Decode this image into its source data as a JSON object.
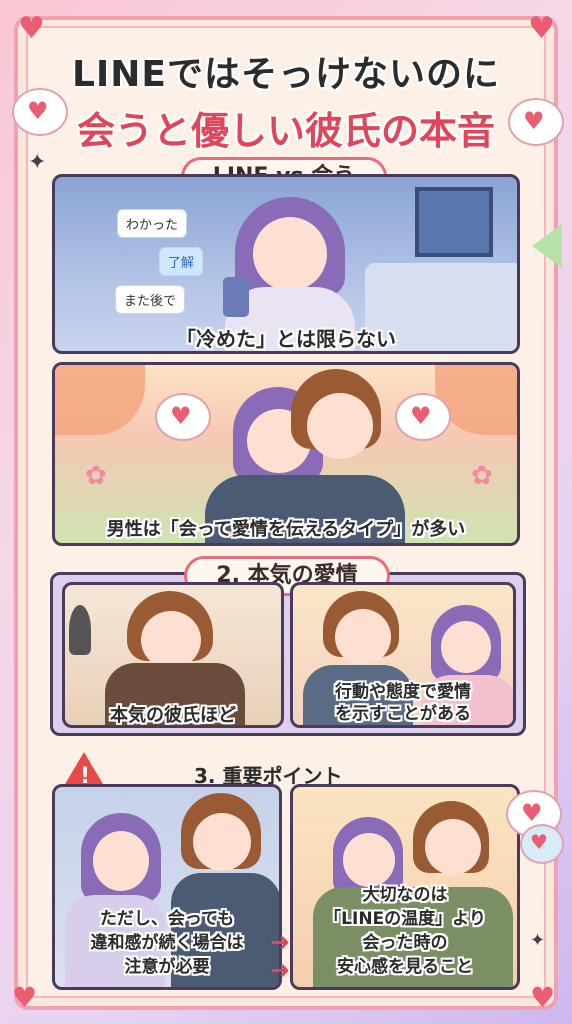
{
  "title": {
    "line1": "LINEではそっけないのに",
    "line2": "会うと優しい彼氏の本音"
  },
  "sections": {
    "s1_label": "LINE vs 会う",
    "s2_label": "2. 本気の愛情",
    "s3_label": "3. 重要ポイント"
  },
  "chat": {
    "msg1": "わかった",
    "msg2": "了解",
    "msg3": "また後で"
  },
  "captions": {
    "c1": "「冷めた」とは限らない",
    "c2": "男性は「会って愛情を伝えるタイプ」が多い",
    "c3": "本気の彼氏ほど",
    "c4_line1": "行動や態度で愛情",
    "c4_line2": "を示すことがある",
    "c5_line1": "ただし、会っても",
    "c5_line2": "違和感が続く場合は",
    "c5_line3": "注意が必要",
    "c6_line1": "大切なのは",
    "c6_line2": "「LINEの温度」より",
    "c6_line3": "会った時の",
    "c6_line4": "安心感を見ること"
  },
  "icons": [
    "heart-icon",
    "warning-icon",
    "sparkle-icon",
    "arrow-right-icon",
    "chat-bubble-heart-icon"
  ],
  "colors": {
    "accent": "#e0465a",
    "frame": "#f0a1b4",
    "panel_border": "#4b3b5b",
    "hair_purple": "#8a6bb8",
    "hair_brown": "#9a5a33"
  }
}
